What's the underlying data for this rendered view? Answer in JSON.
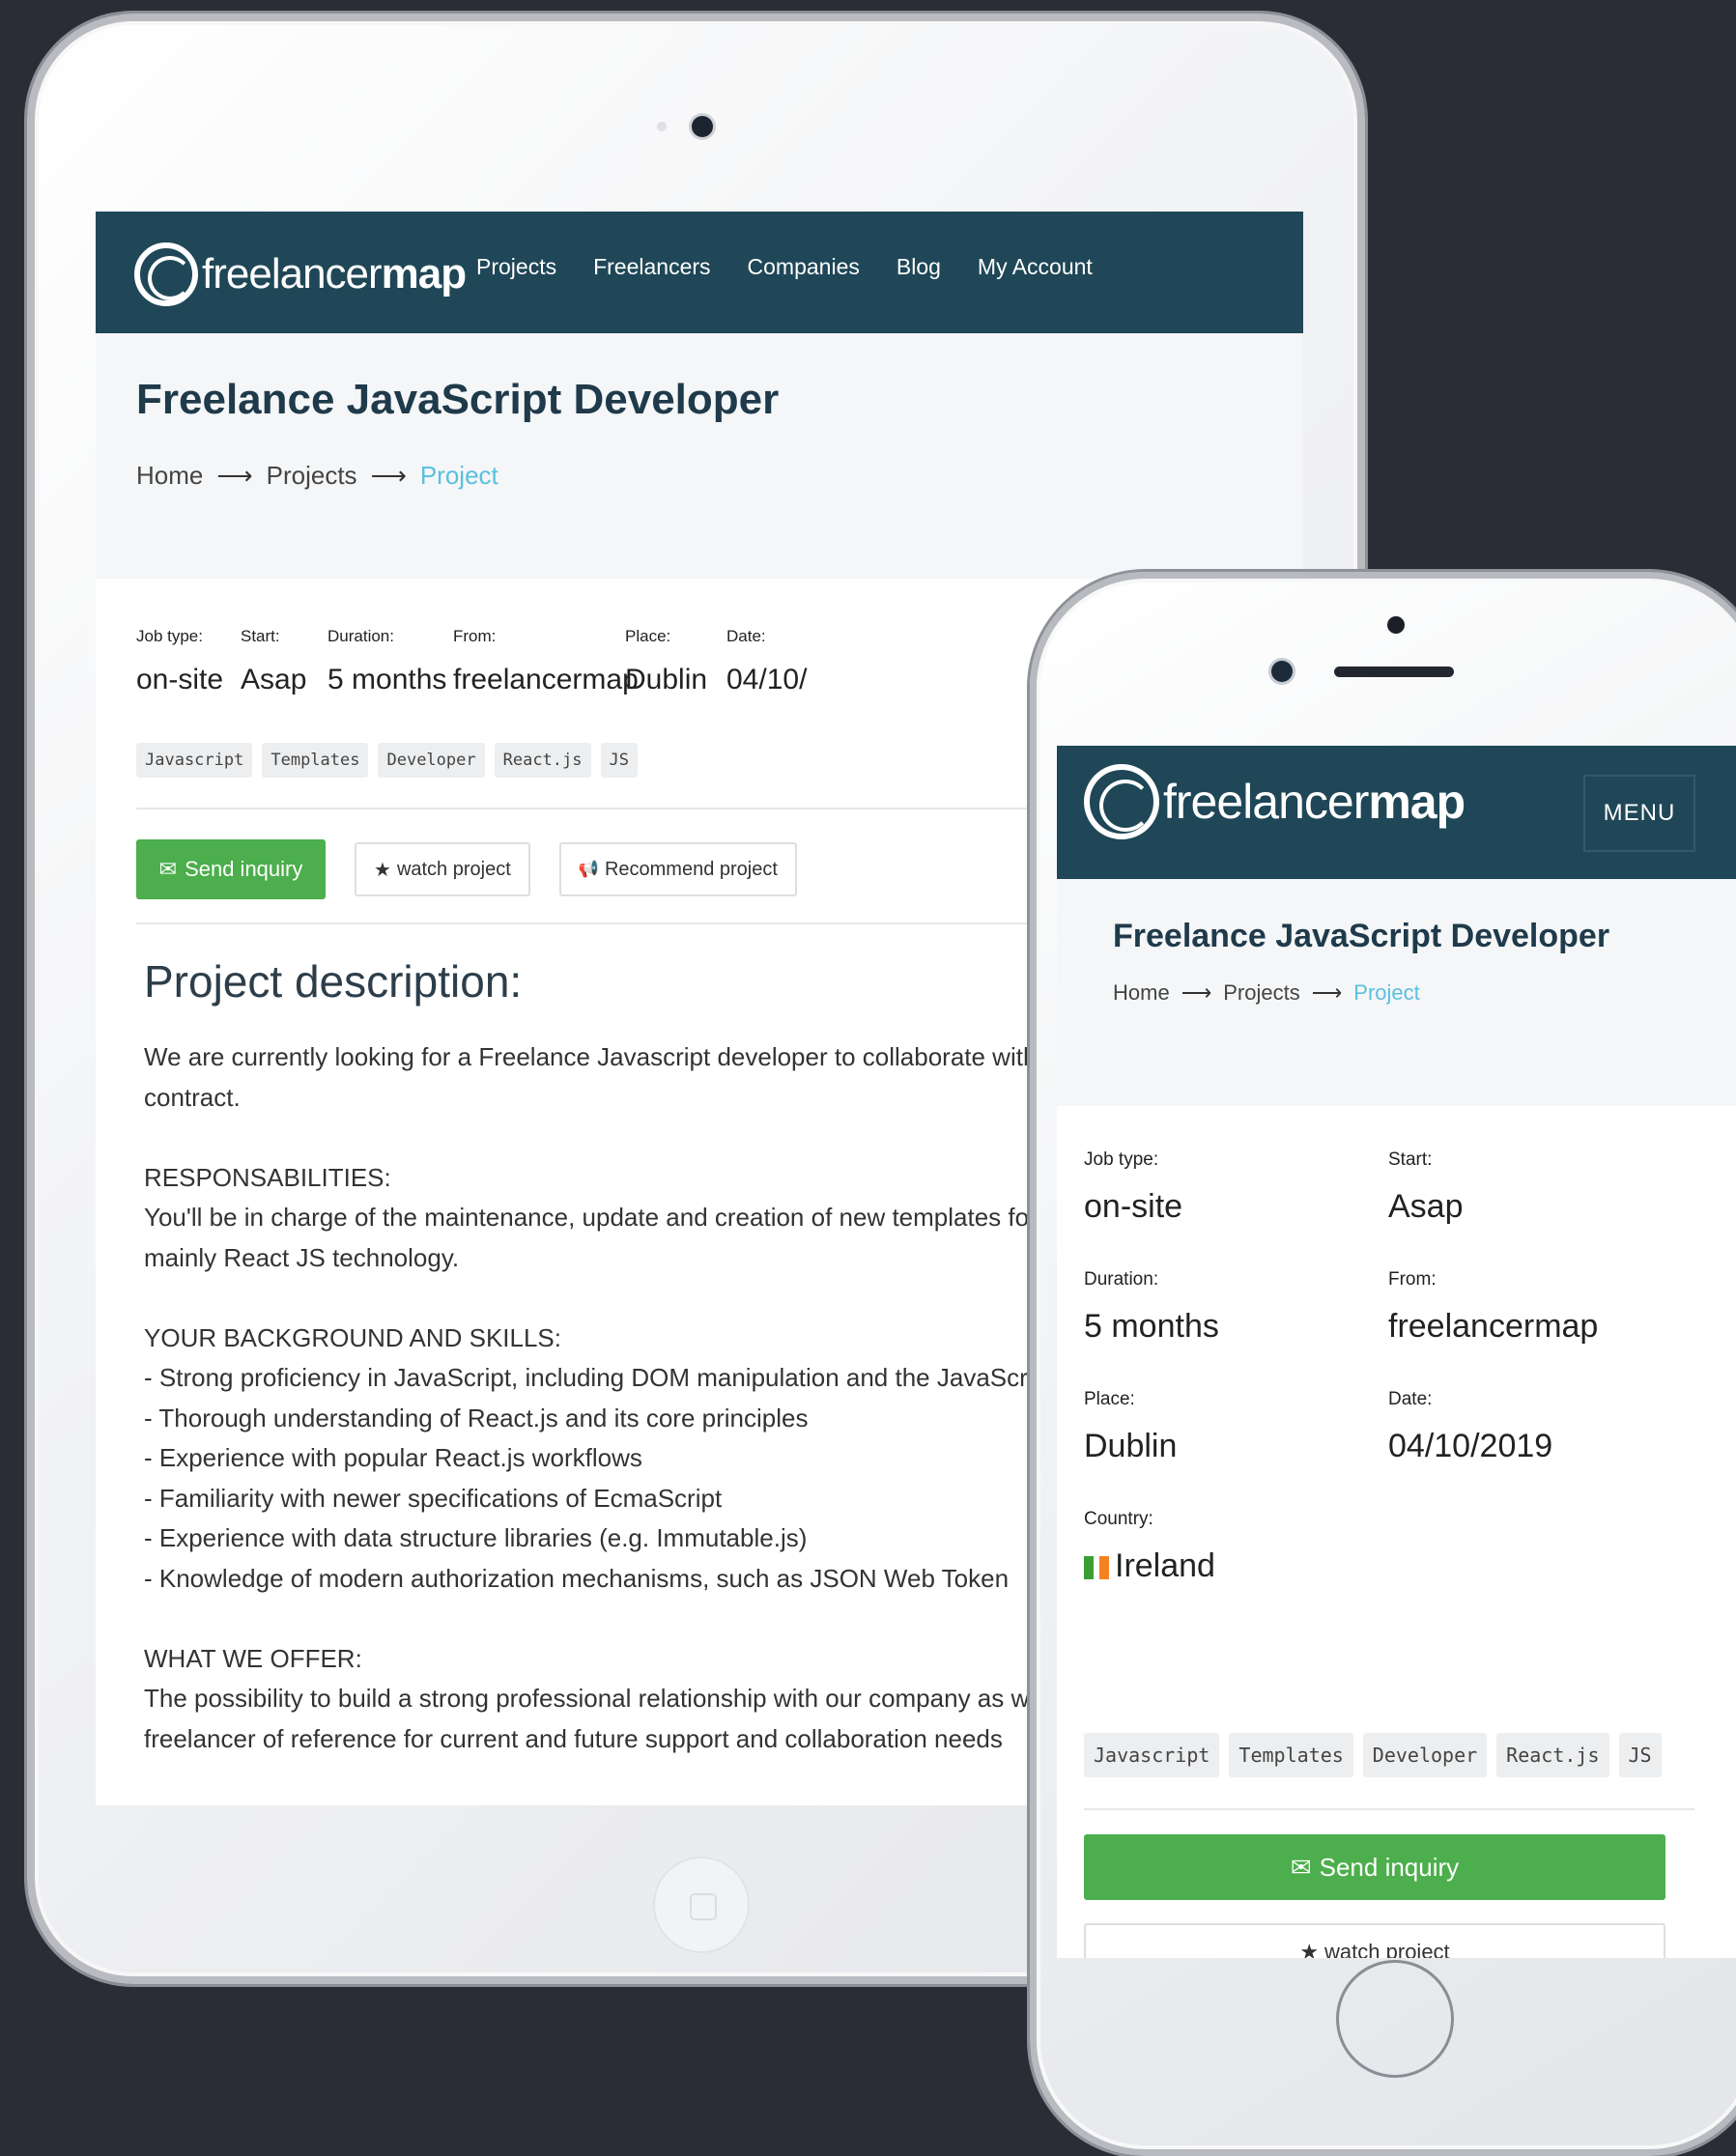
{
  "brand": {
    "logo_light": "freelancer",
    "logo_bold": "map",
    "nav_color": "#1f4757",
    "accent_color": "#5bc0de",
    "button_green": "#4cae4c"
  },
  "nav": {
    "items": [
      "Projects",
      "Freelancers",
      "Companies",
      "Blog",
      "My Account"
    ],
    "menu_label": "MENU"
  },
  "page": {
    "title": "Freelance JavaScript Developer",
    "breadcrumb": [
      "Home",
      "Projects",
      "Project"
    ],
    "breadcrumb_separator": "⟶"
  },
  "facts": {
    "job_type": {
      "label": "Job type:",
      "value": "on-site"
    },
    "start": {
      "label": "Start:",
      "value": "Asap"
    },
    "duration": {
      "label": "Duration:",
      "value": "5 months"
    },
    "from": {
      "label": "From:",
      "value": "freelancermap"
    },
    "place": {
      "label": "Place:",
      "value": "Dublin"
    },
    "date": {
      "label": "Date:",
      "value": "04/10/2019",
      "tablet_value": "04/10/"
    },
    "country": {
      "label": "Country:",
      "value": "Ireland",
      "flag_colors": [
        "#3a9e34",
        "#ffffff",
        "#f58220"
      ]
    }
  },
  "tags": [
    "Javascript",
    "Templates",
    "Developer",
    "React.js",
    "JS"
  ],
  "actions": {
    "send_inquiry": "Send inquiry",
    "watch_project": "watch project",
    "recommend_project": "Recommend project"
  },
  "description": {
    "heading": "Project description:",
    "lines": [
      "We are currently looking for a Freelance Javascript developer to collaborate with u",
      "contract.",
      "",
      "RESPONSABILITIES:",
      "You'll be in charge of the maintenance, update and creation of new templates for ou",
      "mainly React JS technology.",
      "",
      "YOUR BACKGROUND AND SKILLS:",
      "- Strong proficiency in JavaScript, including DOM manipulation and the JavaScript",
      "- Thorough understanding of React.js and its core principles",
      "- Experience with popular React.js workflows",
      "- Familiarity with newer specifications of EcmaScript",
      "- Experience with data structure libraries (e.g. Immutable.js)",
      "- Knowledge of modern authorization mechanisms, such as JSON Web Token",
      "",
      "WHAT WE OFFER:",
      "The possibility to build a strong professional relationship with our company as we a",
      "freelancer of reference for current and future support and collaboration needs"
    ]
  },
  "icons": {
    "envelope": "✉",
    "star": "★",
    "megaphone": "📢"
  }
}
